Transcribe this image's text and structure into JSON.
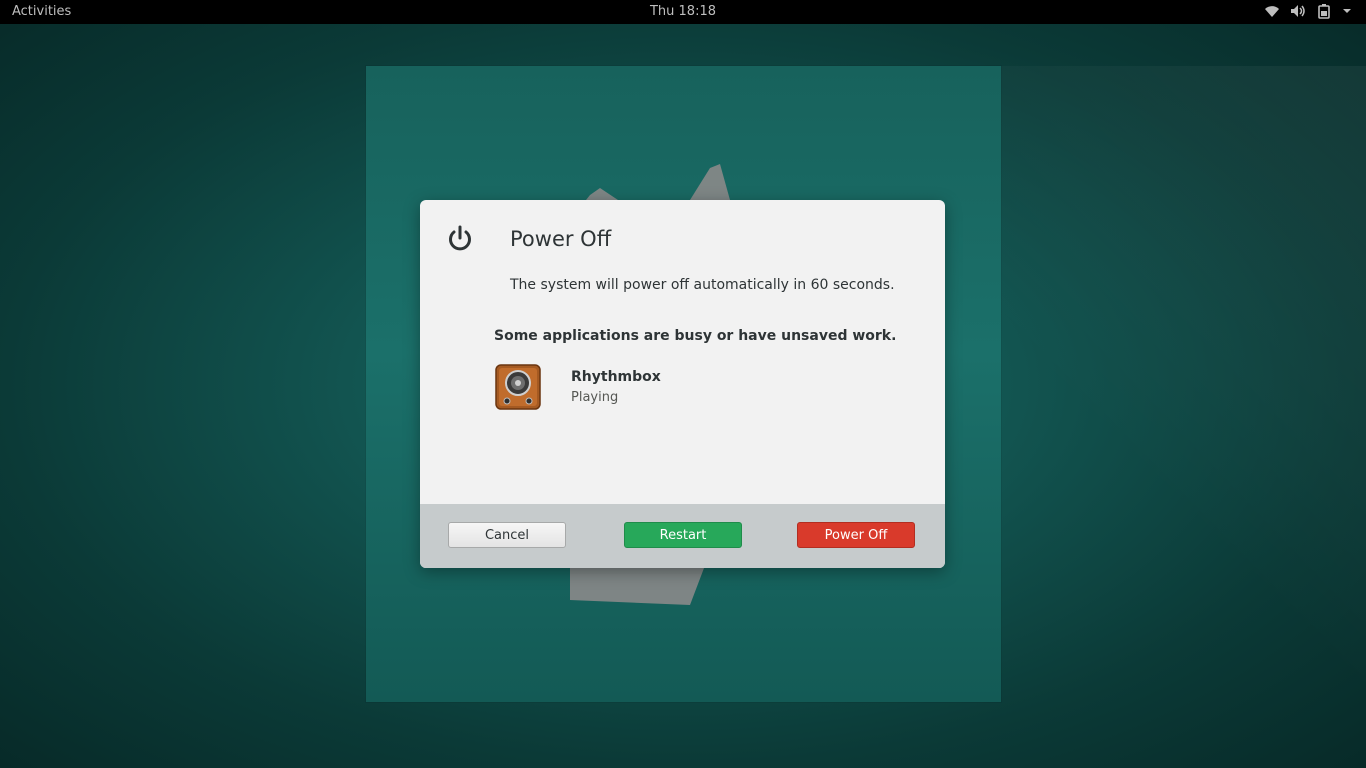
{
  "topbar": {
    "activities_label": "Activities",
    "clock": "Thu 18:18",
    "tray_icons": [
      "wifi-icon",
      "volume-icon",
      "battery-icon",
      "chevron-down-icon"
    ]
  },
  "dialog": {
    "icon": "power-icon",
    "title": "Power Off",
    "description": "The system will power off automatically in 60 seconds.",
    "busy_heading": "Some applications are busy or have unsaved work.",
    "apps": [
      {
        "icon": "rhythmbox-icon",
        "name": "Rhythmbox",
        "status": "Playing"
      }
    ],
    "buttons": {
      "cancel": "Cancel",
      "restart": "Restart",
      "power_off": "Power Off"
    }
  },
  "colors": {
    "restart_button": "#27a85a",
    "power_off_button": "#d93a2b",
    "desktop_bg": "#125450"
  }
}
